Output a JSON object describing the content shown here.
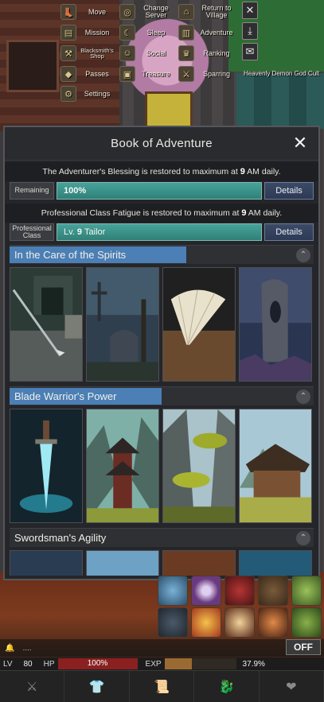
{
  "top_menu": {
    "items": [
      {
        "label": "Move",
        "icon": "boot-icon"
      },
      {
        "label": "Change Server",
        "icon": "globe-icon"
      },
      {
        "label": "Return to Village",
        "icon": "house-icon"
      },
      {
        "label": "Mission",
        "icon": "book-icon"
      },
      {
        "label": "Sleep",
        "icon": "sleep-icon"
      },
      {
        "label": "Adventure",
        "icon": "adventure-book-icon"
      },
      {
        "label": "Blacksmith's Shop",
        "icon": "anvil-icon"
      },
      {
        "label": "Social",
        "icon": "people-icon"
      },
      {
        "label": "Ranking",
        "icon": "trophy-icon"
      },
      {
        "label": "Passes",
        "icon": "pass-icon"
      },
      {
        "label": "Treasure",
        "icon": "chest-icon"
      },
      {
        "label": "Sparring",
        "icon": "swords-icon"
      },
      {
        "label": "Settings",
        "icon": "gear-icon"
      }
    ],
    "right_caption": "Heavenly Demon God Cult"
  },
  "modal": {
    "title": "Book of Adventure",
    "blessing_info": {
      "before": "The Adventurer's Blessing is restored to maximum at ",
      "bold": "9",
      "after": " AM daily."
    },
    "remaining": {
      "label": "Remaining",
      "value": "100%",
      "percent": 100
    },
    "fatigue_info": {
      "before": "Professional Class Fatigue is restored to maximum at ",
      "bold": "9",
      "after": " AM daily."
    },
    "prof_class": {
      "label": "Professional Class",
      "level_prefix": "Lv.",
      "level": "9",
      "name": "Tailor",
      "percent": 100
    },
    "details_label": "Details",
    "sections": [
      {
        "title": "In the Care of the Spirits",
        "progress": 0.58
      },
      {
        "title": "Blade Warrior's Power",
        "progress": 0.5
      },
      {
        "title": "Swordsman's Agility",
        "progress": 0
      }
    ]
  },
  "status": {
    "chat_text": "....",
    "off_label": "OFF",
    "lv_label": "LV",
    "lv_value": "80",
    "hp_label": "HP",
    "hp_value": "100%",
    "hp_percent": 100,
    "exp_label": "EXP",
    "exp_value": "37.9%",
    "exp_percent": 37.9
  },
  "bottom_nav": [
    "sword-icon",
    "armor-icon",
    "scroll-icon",
    "dragon-icon",
    "heart-icon"
  ]
}
